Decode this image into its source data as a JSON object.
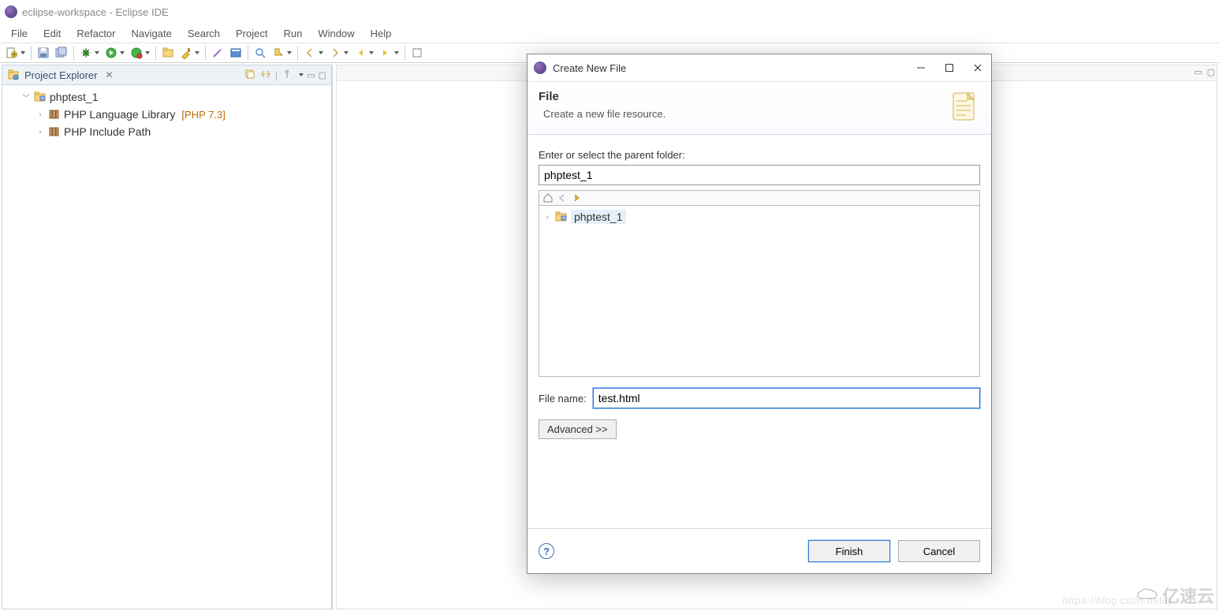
{
  "window": {
    "title": "eclipse-workspace - Eclipse IDE"
  },
  "menu": [
    "File",
    "Edit",
    "Refactor",
    "Navigate",
    "Search",
    "Project",
    "Run",
    "Window",
    "Help"
  ],
  "projectExplorer": {
    "title": "Project Explorer",
    "nodes": {
      "root": {
        "label": "phptest_1"
      },
      "lib": {
        "label": "PHP Language Library",
        "extra": "[PHP 7.3]"
      },
      "inc": {
        "label": "PHP Include Path"
      }
    }
  },
  "dialog": {
    "title": "Create New File",
    "bannerTitle": "File",
    "bannerDesc": "Create a new file resource.",
    "parentLabel": "Enter or select the parent folder:",
    "parentValue": "phptest_1",
    "treeRoot": "phptest_1",
    "fileNameLabel": "File name:",
    "fileNameValue": "test.html",
    "advanced": "Advanced >>",
    "finish": "Finish",
    "cancel": "Cancel"
  },
  "watermark": "https://blog.csdn.net/q",
  "logo": "亿速云"
}
